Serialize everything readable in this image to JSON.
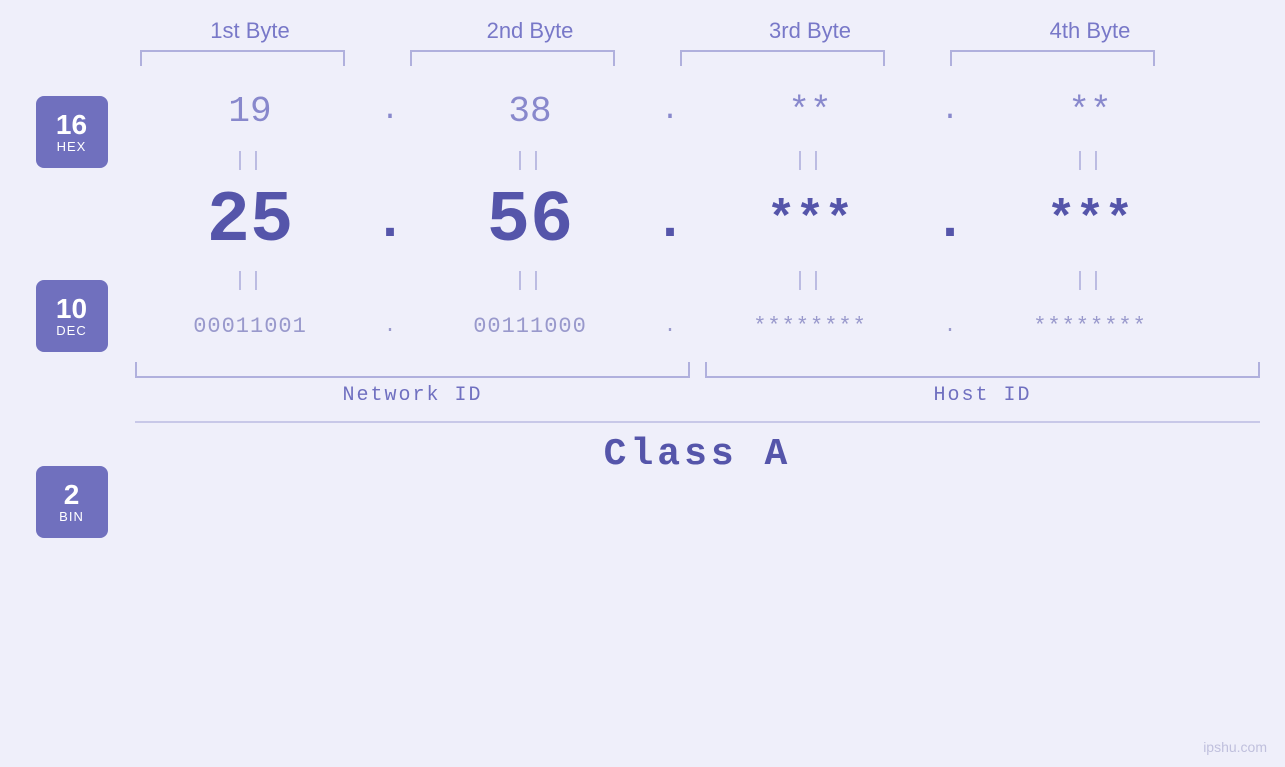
{
  "page": {
    "background": "#efeffa",
    "watermark": "ipshu.com"
  },
  "headers": {
    "byte1": "1st Byte",
    "byte2": "2nd Byte",
    "byte3": "3rd Byte",
    "byte4": "4th Byte"
  },
  "badges": {
    "hex": {
      "number": "16",
      "label": "HEX"
    },
    "dec": {
      "number": "10",
      "label": "DEC"
    },
    "bin": {
      "number": "2",
      "label": "BIN"
    }
  },
  "hex": {
    "b1": "19",
    "b2": "38",
    "b3": "**",
    "b4": "**",
    "dot": "."
  },
  "dec": {
    "b1": "25",
    "b2": "56",
    "b3": "***",
    "b4": "***",
    "dot": "."
  },
  "bin": {
    "b1": "00011001",
    "b2": "00111000",
    "b3": "********",
    "b4": "********",
    "dot": "."
  },
  "labels": {
    "network_id": "Network ID",
    "host_id": "Host ID",
    "class": "Class A"
  },
  "equals": "||"
}
